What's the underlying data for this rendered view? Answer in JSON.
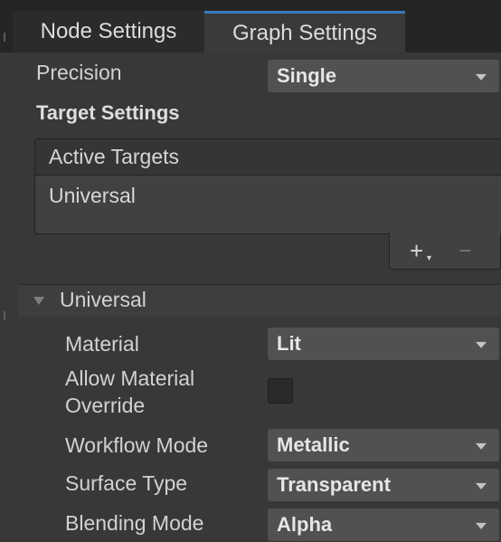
{
  "tabs": {
    "node_settings": "Node Settings",
    "graph_settings": "Graph Settings"
  },
  "precision": {
    "label": "Precision",
    "value": "Single"
  },
  "target_settings": {
    "title": "Target Settings"
  },
  "active_targets": {
    "header": "Active Targets",
    "items": [
      "Universal"
    ],
    "add_label": "+",
    "remove_label": "−"
  },
  "universal": {
    "title": "Universal",
    "material": {
      "label": "Material",
      "value": "Lit"
    },
    "allow_material_override": {
      "label_line1": "Allow Material",
      "label_line2": "Override",
      "checked": false
    },
    "workflow_mode": {
      "label": "Workflow Mode",
      "value": "Metallic"
    },
    "surface_type": {
      "label": "Surface Type",
      "value": "Transparent"
    },
    "blending_mode": {
      "label": "Blending Mode",
      "value": "Alpha"
    }
  },
  "colors": {
    "background": "#383838",
    "tab_active_accent": "#3a79bb",
    "dropdown": "#515151"
  }
}
